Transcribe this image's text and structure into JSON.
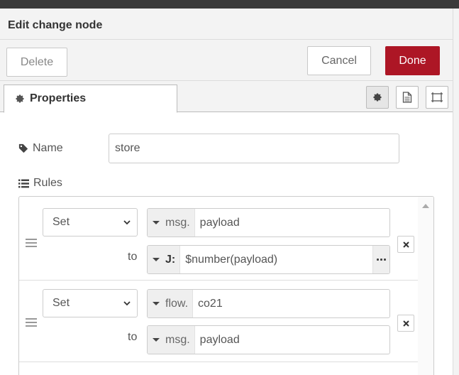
{
  "tray": {
    "title": "Edit change node"
  },
  "toolbar": {
    "delete_label": "Delete",
    "cancel_label": "Cancel",
    "done_label": "Done"
  },
  "tabs": {
    "properties_label": "Properties"
  },
  "form": {
    "name_label": "Name",
    "name_value": "store",
    "rules_label": "Rules"
  },
  "rules": [
    {
      "action": "Set",
      "target_type": "msg.",
      "target_value": "payload",
      "to_label": "to",
      "source_type": "J:",
      "source_value": "$number(payload)"
    },
    {
      "action": "Set",
      "target_type": "flow.",
      "target_value": "co21",
      "to_label": "to",
      "source_type": "msg.",
      "source_value": "payload"
    }
  ],
  "colors": {
    "done": "#ad1625",
    "header_bg": "#f3f3f3",
    "topbar": "#3b3b3b"
  }
}
